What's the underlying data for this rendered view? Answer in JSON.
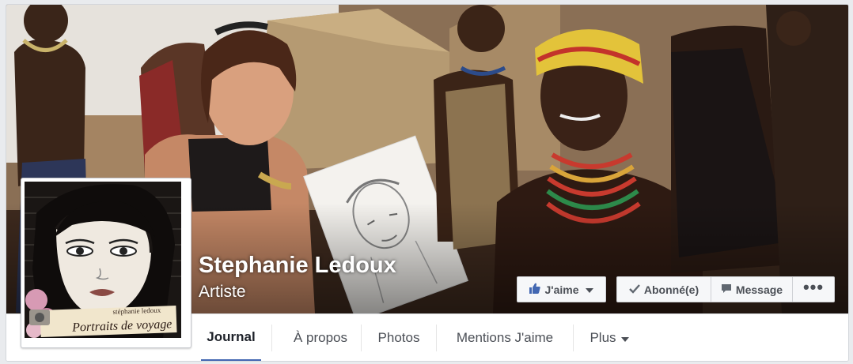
{
  "profile": {
    "name": "Stephanie Ledoux",
    "category": "Artiste",
    "picture_caption": "Portraits de voyage",
    "picture_signature": "stéphanie ledoux"
  },
  "actions": {
    "like_label": "J'aime",
    "subscribed_label": "Abonné(e)",
    "message_label": "Message",
    "more_label": "•••"
  },
  "nav": {
    "tabs": [
      {
        "label": "Journal",
        "active": true
      },
      {
        "label": "À propos",
        "active": false
      },
      {
        "label": "Photos",
        "active": false
      },
      {
        "label": "Mentions J'aime",
        "active": false
      },
      {
        "label": "Plus",
        "active": false
      }
    ]
  },
  "colors": {
    "accent": "#4267b2",
    "like_blue": "#4267b2",
    "button_bg": "#f6f7f9",
    "page_bg": "#e9ebee"
  },
  "icons": {
    "like": "thumbs-up-icon",
    "subscribed": "checkmark-icon",
    "message": "speech-bubble-icon",
    "more": "ellipsis-icon"
  }
}
